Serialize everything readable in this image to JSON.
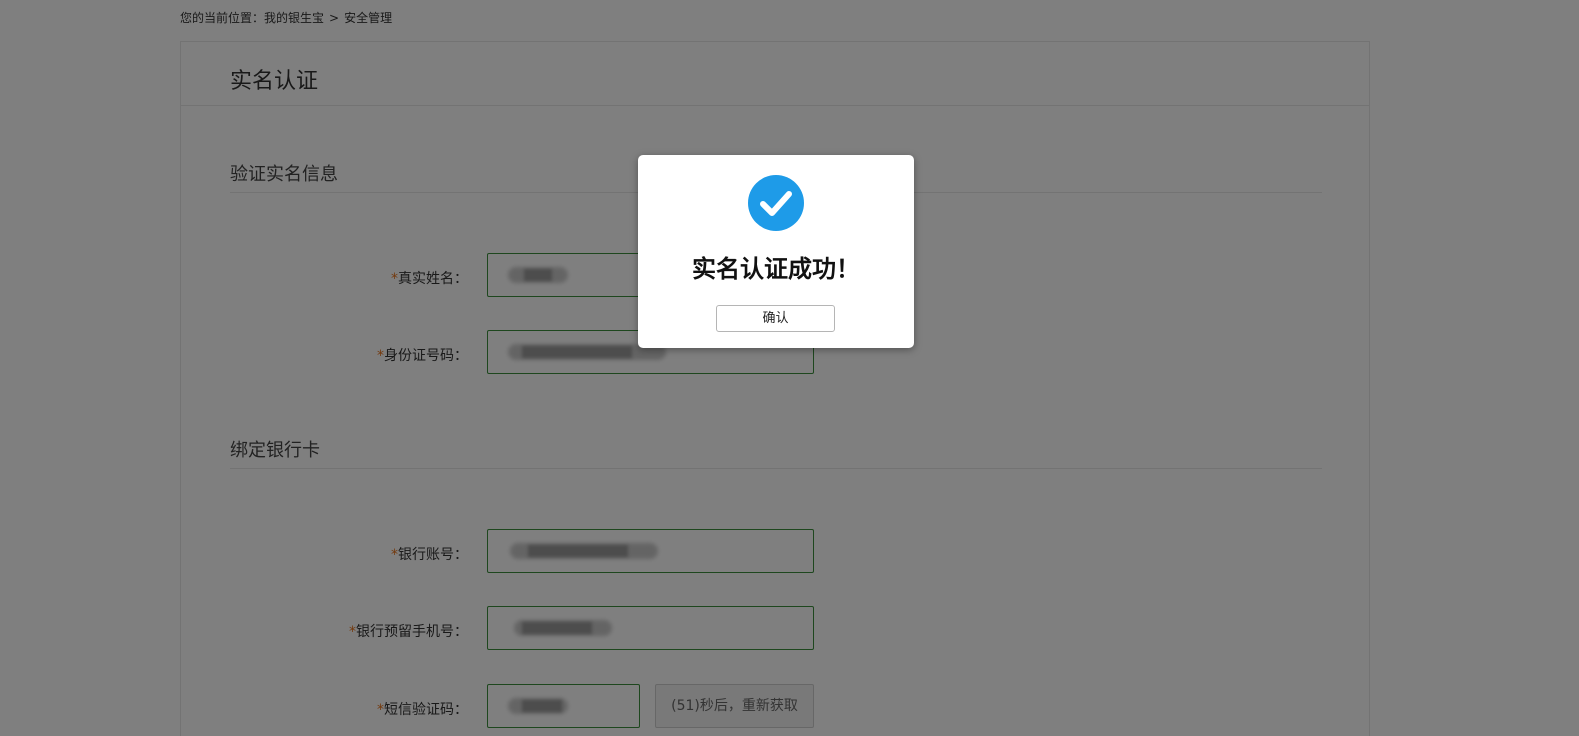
{
  "breadcrumb": {
    "prefix": "您的当前位置：",
    "home": "我的银生宝",
    "separator": ">",
    "current": "安全管理"
  },
  "page": {
    "title": "实名认证"
  },
  "sections": {
    "verify": {
      "title": "验证实名信息",
      "fields": {
        "name": {
          "star": "*",
          "label": "真实姓名："
        },
        "id_number": {
          "star": "*",
          "label": "身份证号码："
        }
      }
    },
    "bank": {
      "title": "绑定银行卡",
      "fields": {
        "account": {
          "star": "*",
          "label": "银行账号："
        },
        "phone": {
          "star": "*",
          "label": "银行预留手机号："
        },
        "sms_code": {
          "star": "*",
          "label": "短信验证码："
        }
      },
      "sms_button": "(51)秒后，重新获取"
    }
  },
  "modal": {
    "icon": "check-circle-icon",
    "icon_color": "#1e9be8",
    "message": "实名认证成功！",
    "confirm_label": "确认"
  },
  "colors": {
    "required_star": "#e8731a",
    "input_border": "#3c8f3c",
    "overlay": "rgba(0,0,0,0.5)"
  }
}
